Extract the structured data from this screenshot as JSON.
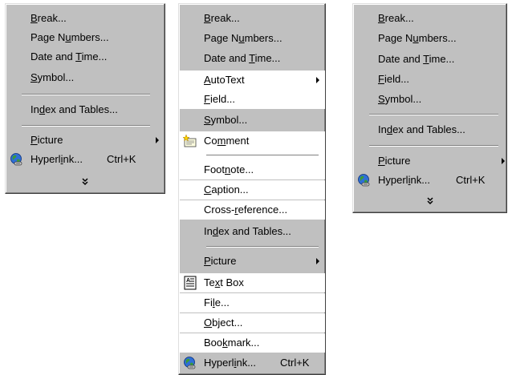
{
  "menu_left": {
    "items": {
      "break": {
        "pre": "",
        "u": "B",
        "post": "reak..."
      },
      "page_numbers": {
        "pre": "Page N",
        "u": "u",
        "post": "mbers..."
      },
      "date_time": {
        "pre": "Date and ",
        "u": "T",
        "post": "ime..."
      },
      "symbol": {
        "pre": "",
        "u": "S",
        "post": "ymbol..."
      },
      "index_tables": {
        "pre": "In",
        "u": "d",
        "post": "ex and Tables..."
      },
      "picture": {
        "pre": "",
        "u": "P",
        "post": "icture"
      },
      "hyperlink": {
        "pre": "Hyperl",
        "u": "i",
        "post": "nk...",
        "shortcut": "Ctrl+K"
      }
    },
    "expand_glyph": "»"
  },
  "menu_middle": {
    "items": {
      "break": {
        "pre": "",
        "u": "B",
        "post": "reak..."
      },
      "page_numbers": {
        "pre": "Page N",
        "u": "u",
        "post": "mbers..."
      },
      "date_time": {
        "pre": "Date and ",
        "u": "T",
        "post": "ime..."
      },
      "autotext": {
        "pre": "",
        "u": "A",
        "post": "utoText"
      },
      "field": {
        "pre": "",
        "u": "F",
        "post": "ield..."
      },
      "symbol": {
        "pre": "",
        "u": "S",
        "post": "ymbol..."
      },
      "comment": {
        "pre": "Co",
        "u": "m",
        "post": "ment"
      },
      "footnote": {
        "pre": "Foot",
        "u": "n",
        "post": "ote..."
      },
      "caption": {
        "pre": "",
        "u": "C",
        "post": "aption..."
      },
      "cross_reference": {
        "pre": "Cross-",
        "u": "r",
        "post": "eference..."
      },
      "index_tables": {
        "pre": "In",
        "u": "d",
        "post": "ex and Tables..."
      },
      "picture": {
        "pre": "",
        "u": "P",
        "post": "icture"
      },
      "text_box": {
        "pre": "Te",
        "u": "x",
        "post": "t Box"
      },
      "file": {
        "pre": "Fi",
        "u": "l",
        "post": "e..."
      },
      "object": {
        "pre": "",
        "u": "O",
        "post": "bject..."
      },
      "bookmark": {
        "pre": "Boo",
        "u": "k",
        "post": "mark..."
      },
      "hyperlink": {
        "pre": "Hyperl",
        "u": "i",
        "post": "nk...",
        "shortcut": "Ctrl+K"
      }
    }
  },
  "menu_right": {
    "items": {
      "break": {
        "pre": "",
        "u": "B",
        "post": "reak..."
      },
      "page_numbers": {
        "pre": "Page N",
        "u": "u",
        "post": "mbers..."
      },
      "date_time": {
        "pre": "Date and ",
        "u": "T",
        "post": "ime..."
      },
      "field": {
        "pre": "",
        "u": "F",
        "post": "ield..."
      },
      "symbol": {
        "pre": "",
        "u": "S",
        "post": "ymbol..."
      },
      "index_tables": {
        "pre": "In",
        "u": "d",
        "post": "ex and Tables..."
      },
      "picture": {
        "pre": "",
        "u": "P",
        "post": "icture"
      },
      "hyperlink": {
        "pre": "Hyperl",
        "u": "i",
        "post": "nk...",
        "shortcut": "Ctrl+K"
      }
    },
    "expand_glyph": "»"
  },
  "colors": {
    "menu_face": "#c0c0c0",
    "recent_highlight": "#ffffff"
  }
}
